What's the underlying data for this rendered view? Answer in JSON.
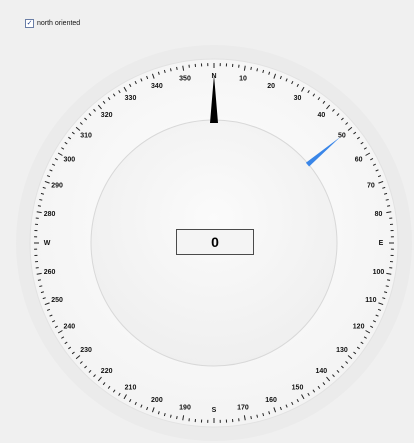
{
  "north_oriented_checkbox": {
    "label": "north oriented",
    "checked": true
  },
  "compass": {
    "heading_value": "0",
    "north_needle_color": "#000000",
    "bearing_marker_color": "#3a86e8",
    "bearing_marker_degrees": 50,
    "labels": [
      {
        "angle": 0,
        "text": "N"
      },
      {
        "angle": 10,
        "text": "10"
      },
      {
        "angle": 20,
        "text": "20"
      },
      {
        "angle": 30,
        "text": "30"
      },
      {
        "angle": 40,
        "text": "40"
      },
      {
        "angle": 50,
        "text": "50"
      },
      {
        "angle": 60,
        "text": "60"
      },
      {
        "angle": 70,
        "text": "70"
      },
      {
        "angle": 80,
        "text": "80"
      },
      {
        "angle": 90,
        "text": "E"
      },
      {
        "angle": 100,
        "text": "100"
      },
      {
        "angle": 110,
        "text": "110"
      },
      {
        "angle": 120,
        "text": "120"
      },
      {
        "angle": 130,
        "text": "130"
      },
      {
        "angle": 140,
        "text": "140"
      },
      {
        "angle": 150,
        "text": "150"
      },
      {
        "angle": 160,
        "text": "160"
      },
      {
        "angle": 170,
        "text": "170"
      },
      {
        "angle": 180,
        "text": "S"
      },
      {
        "angle": 190,
        "text": "190"
      },
      {
        "angle": 200,
        "text": "200"
      },
      {
        "angle": 210,
        "text": "210"
      },
      {
        "angle": 220,
        "text": "220"
      },
      {
        "angle": 230,
        "text": "230"
      },
      {
        "angle": 240,
        "text": "240"
      },
      {
        "angle": 250,
        "text": "250"
      },
      {
        "angle": 260,
        "text": "260"
      },
      {
        "angle": 270,
        "text": "W"
      },
      {
        "angle": 280,
        "text": "280"
      },
      {
        "angle": 290,
        "text": "290"
      },
      {
        "angle": 300,
        "text": "300"
      },
      {
        "angle": 310,
        "text": "310"
      },
      {
        "angle": 320,
        "text": "320"
      },
      {
        "angle": 330,
        "text": "330"
      },
      {
        "angle": 340,
        "text": "340"
      },
      {
        "angle": 350,
        "text": "350"
      }
    ]
  }
}
